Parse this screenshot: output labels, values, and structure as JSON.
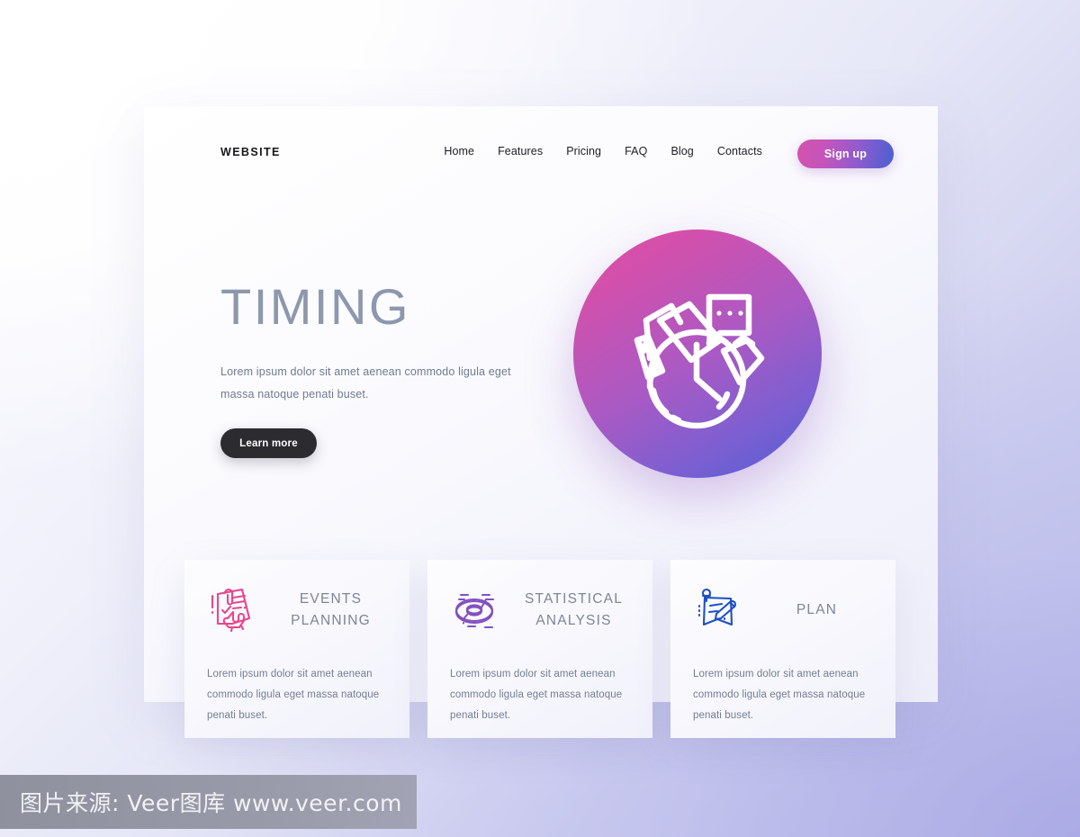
{
  "site": {
    "brand": "WEBSITE",
    "nav": [
      {
        "label": "Home"
      },
      {
        "label": "Features"
      },
      {
        "label": "Pricing"
      },
      {
        "label": "FAQ"
      },
      {
        "label": "Blog"
      },
      {
        "label": "Contacts"
      }
    ],
    "signup_label": "Sign up"
  },
  "hero": {
    "title": "TIMING",
    "description": "Lorem ipsum dolor sit amet aenean commodo ligula eget massa natoque penati buset.",
    "cta_label": "Learn more",
    "illustration": "clock-documents-icon"
  },
  "cards": [
    {
      "title": "EVENTS PLANNING",
      "description": "Lorem ipsum dolor sit amet aenean commodo ligula eget massa natoque penati buset.",
      "icon": "checklist-hand-icon",
      "color": "#e8468c"
    },
    {
      "title": "STATISTICAL ANALYSIS",
      "description": "Lorem ipsum dolor sit amet aenean commodo ligula eget massa natoque penati buset.",
      "icon": "donut-chart-icon",
      "color": "#8350c0"
    },
    {
      "title": "PLAN",
      "description": "Lorem ipsum dolor sit amet aenean commodo ligula eget massa natoque penati buset.",
      "icon": "pinned-note-pen-icon",
      "color": "#1e4fc4"
    }
  ],
  "watermark": {
    "text": "图片来源: Veer图库 www.veer.com"
  },
  "theme": {
    "accent_pink": "#d552ab",
    "accent_blue": "#4a5fd1",
    "heading_gray": "#8d98ae",
    "body_gray": "#6f7a90",
    "dark_button": "#2c2c30"
  }
}
